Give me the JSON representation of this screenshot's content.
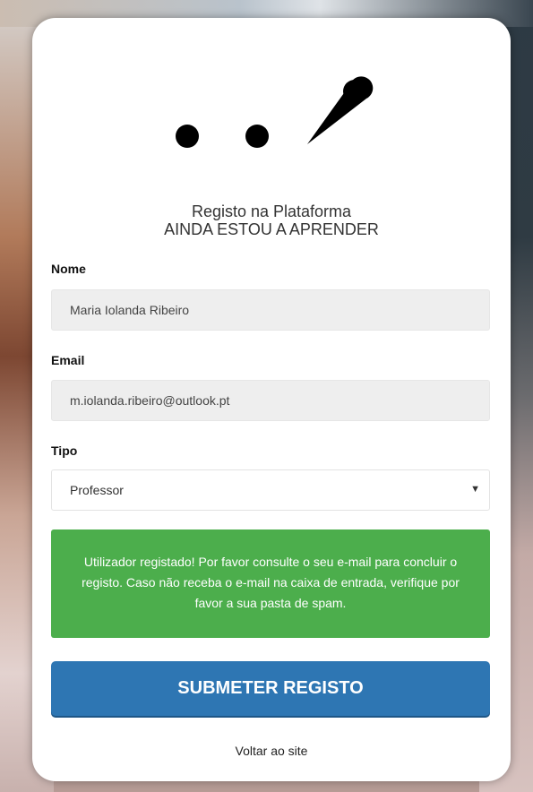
{
  "title": {
    "line1": "Registo na Plataforma",
    "line2": "AINDA ESTOU A APRENDER"
  },
  "form": {
    "name": {
      "label": "Nome",
      "value": "Maria Iolanda Ribeiro"
    },
    "email": {
      "label": "Email",
      "value": "m.iolanda.ribeiro@outlook.pt"
    },
    "type": {
      "label": "Tipo",
      "selected": "Professor"
    }
  },
  "alert": {
    "message": "Utilizador registado! Por favor consulte o seu e-mail para concluir o registo. Caso não receba o e-mail na caixa de entrada, verifique por favor a sua pasta de spam."
  },
  "submit_label": "SUBMETER REGISTO",
  "back_link": "Voltar ao site",
  "colors": {
    "success": "#4cae4c",
    "primary": "#2e76b3"
  }
}
